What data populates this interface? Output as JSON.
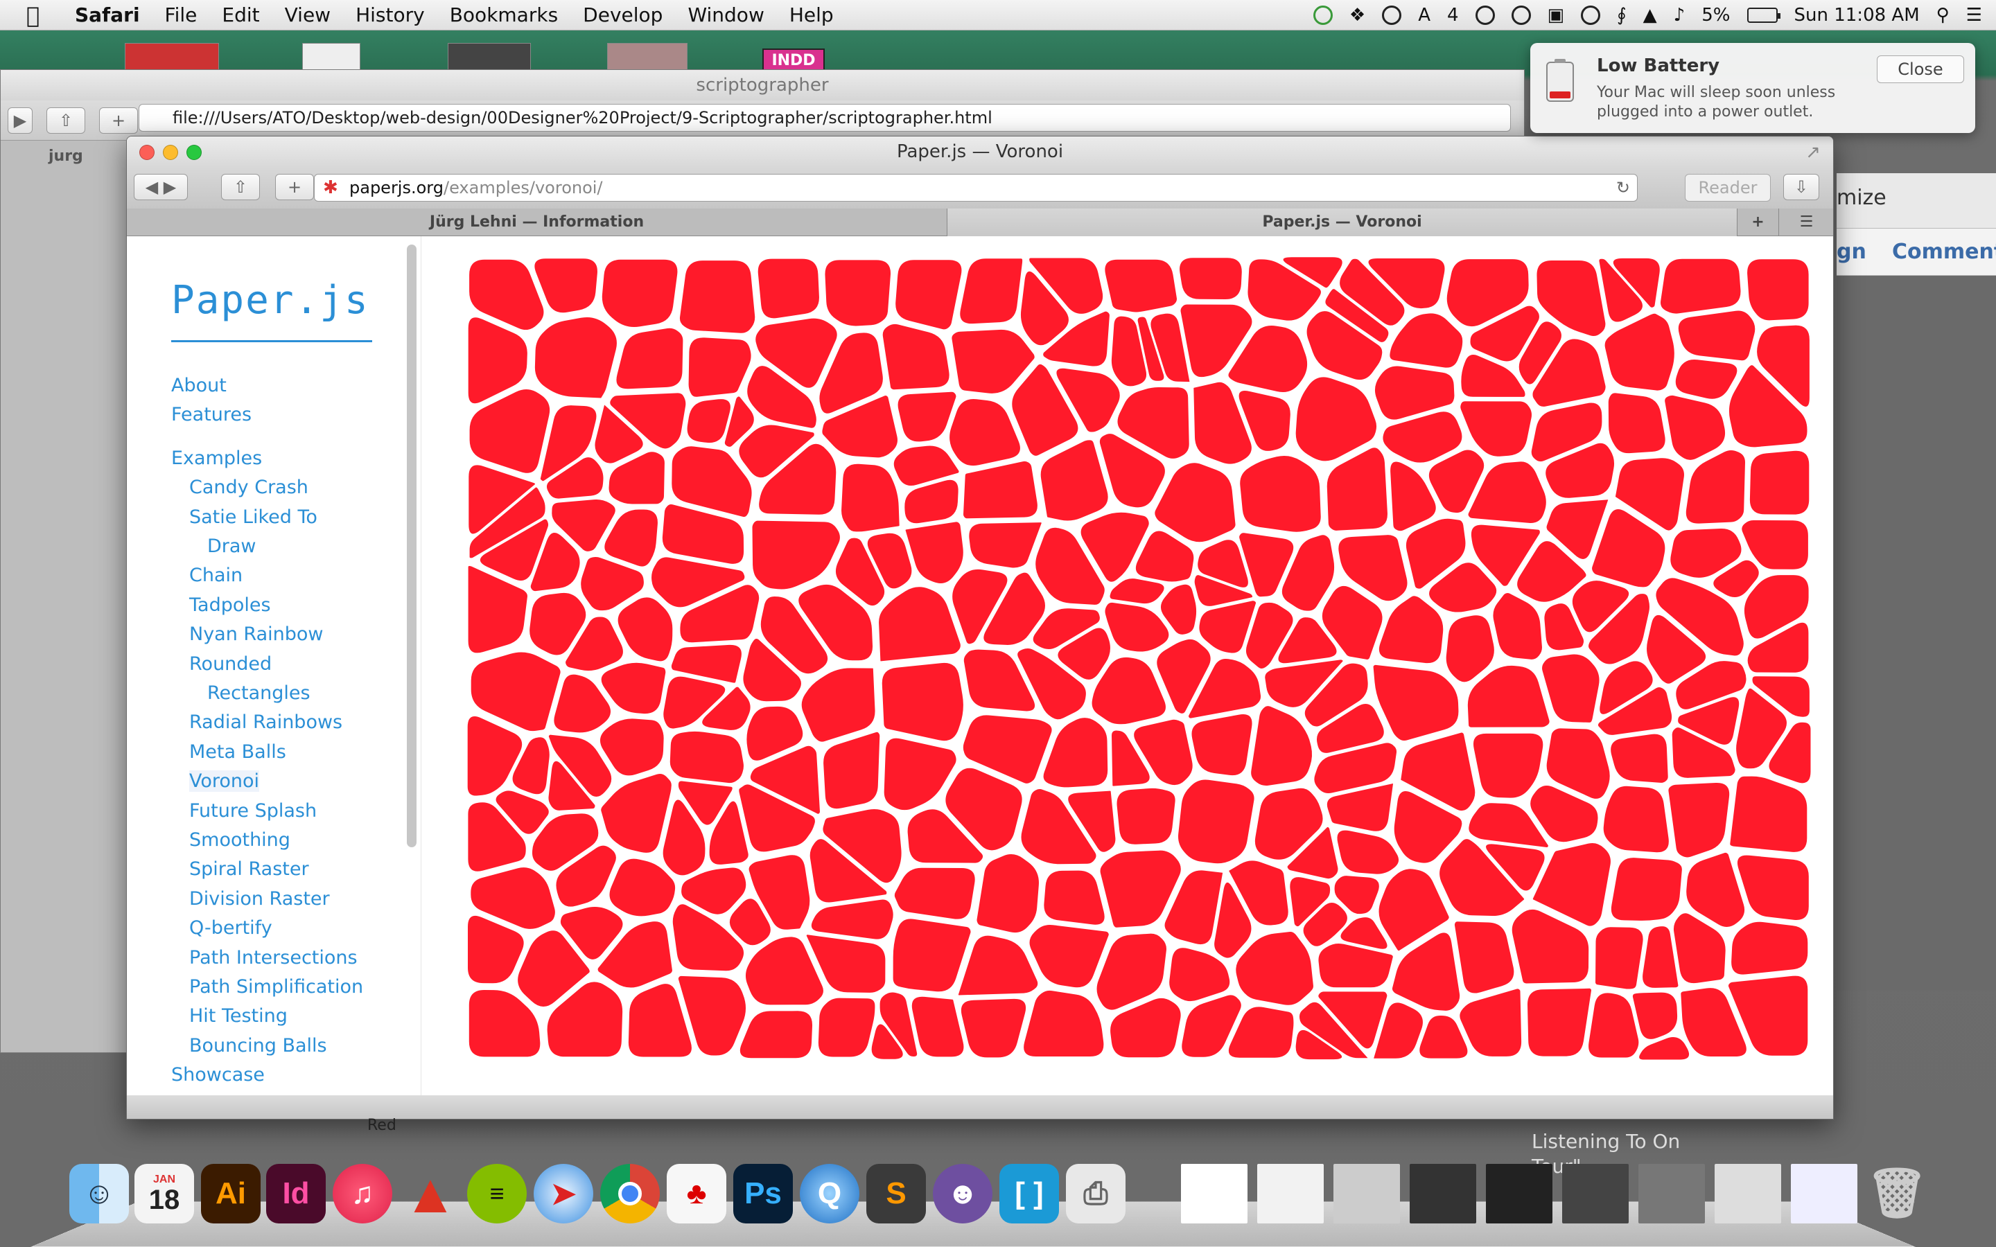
{
  "menubar": {
    "app": "Safari",
    "items": [
      "File",
      "Edit",
      "View",
      "History",
      "Bookmarks",
      "Develop",
      "Window",
      "Help"
    ],
    "adobe_count": "4",
    "battery": "5%",
    "clock": "Sun 11:08 AM"
  },
  "desktop": {
    "indd_badge": "INDD"
  },
  "back_window": {
    "title": "scriptographer",
    "url": "file:///Users/ATO/Desktop/web-design/00Designer%20Project/9-Scriptographer/scriptographer.html",
    "tab_label": "jurg"
  },
  "notification": {
    "title": "Low Battery",
    "body": "Your Mac will sleep soon unless plugged into a power outlet.",
    "close_label": "Close"
  },
  "right_app": {
    "optimize": "mize",
    "sign": "gn",
    "comment": "Comment"
  },
  "main_window": {
    "title": "Paper.js — Voronoi",
    "url_host": "paperjs.org",
    "url_path": "/examples/voronoi/",
    "reader_label": "Reader",
    "tabs": [
      "Jürg Lehni — Information",
      "Paper.js — Voronoi"
    ]
  },
  "page": {
    "logo": "Paper.js",
    "nav": [
      {
        "label": "About",
        "indent": 0
      },
      {
        "label": "Features",
        "indent": 0
      },
      {
        "label": "Examples",
        "indent": 0
      },
      {
        "label": "Candy Crash",
        "indent": 1
      },
      {
        "label": "Satie Liked To",
        "indent": 1
      },
      {
        "label": "Draw",
        "indent": 2
      },
      {
        "label": "Chain",
        "indent": 1
      },
      {
        "label": "Tadpoles",
        "indent": 1
      },
      {
        "label": "Nyan Rainbow",
        "indent": 1
      },
      {
        "label": "Rounded",
        "indent": 1
      },
      {
        "label": "Rectangles",
        "indent": 2
      },
      {
        "label": "Radial Rainbows",
        "indent": 1
      },
      {
        "label": "Meta Balls",
        "indent": 1
      },
      {
        "label": "Voronoi",
        "indent": 1,
        "active": true
      },
      {
        "label": "Future Splash",
        "indent": 1
      },
      {
        "label": "Smoothing",
        "indent": 1
      },
      {
        "label": "Spiral Raster",
        "indent": 1
      },
      {
        "label": "Division Raster",
        "indent": 1
      },
      {
        "label": "Q-bertify",
        "indent": 1
      },
      {
        "label": "Path Intersections",
        "indent": 1
      },
      {
        "label": "Path Simplification",
        "indent": 1
      },
      {
        "label": "Hit Testing",
        "indent": 1
      },
      {
        "label": "Bouncing Balls",
        "indent": 1
      },
      {
        "label": "Showcase",
        "indent": 0
      }
    ]
  },
  "dock": {
    "calendar_month": "JAN",
    "calendar_day": "18",
    "bg_text": "Listening To On Tour\"",
    "red_label": "Red",
    "apps": [
      "finder-icon",
      "calendar-icon",
      "illustrator-icon",
      "indesign-icon",
      "itunes-icon",
      "autocad-icon",
      "spotify-icon",
      "safari-icon",
      "chrome-icon",
      "acrobat-icon",
      "photoshop-icon",
      "quicktime-icon",
      "sublime-icon",
      "github-icon",
      "brackets-icon",
      "printer-icon",
      "trash-icon"
    ],
    "labels": {
      "illustrator": "Ai",
      "indesign": "Id",
      "photoshop": "Ps",
      "sublime": "S"
    }
  },
  "colors": {
    "voronoi_fill": "#ff1a2a",
    "link": "#2b8fd6",
    "desktop_green": "#2f7f5d"
  }
}
